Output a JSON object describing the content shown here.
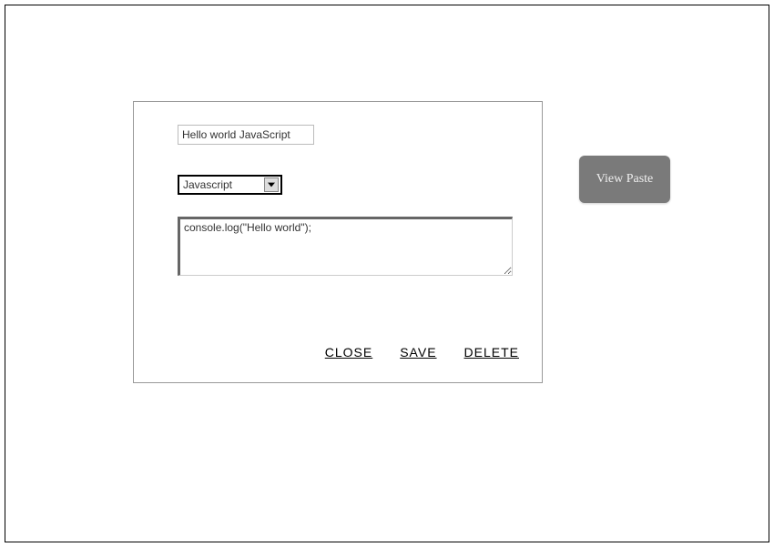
{
  "form": {
    "title_value": "Hello world JavaScript",
    "language_selected": "Javascript",
    "code_value": "console.log(\"Hello world\");"
  },
  "actions": {
    "close_label": "CLOSE",
    "save_label": "SAVE",
    "delete_label": "DELETE"
  },
  "sidebar": {
    "view_paste_label": "View Paste"
  }
}
